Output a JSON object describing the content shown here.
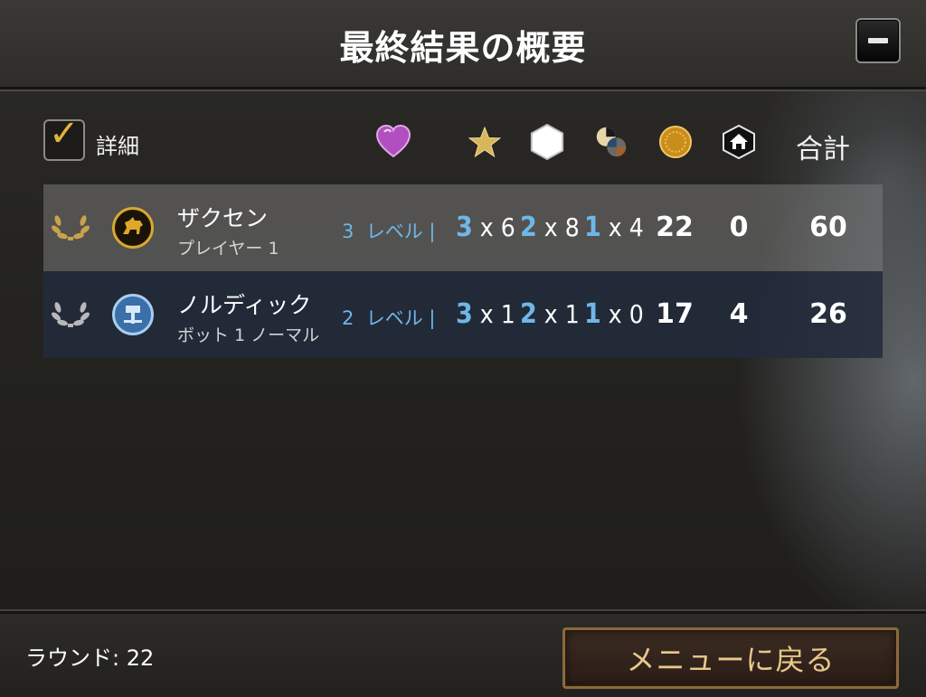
{
  "title": "最終結果の概要",
  "details": {
    "label": "詳細",
    "checked": true
  },
  "columns": {
    "icons": [
      "heart-icon",
      "star-icon",
      "hexagon-icon",
      "resource-mix-icon",
      "coin-icon",
      "home-icon"
    ],
    "total_label": "合計"
  },
  "players": [
    {
      "name": "ザクセン",
      "sub": "プレイヤー 1",
      "level_num": "3",
      "level_text": "レベル",
      "star": {
        "n": "3",
        "x": "x",
        "v": "6"
      },
      "hex": {
        "n": "2",
        "x": "x",
        "v": "8"
      },
      "res": {
        "n": "1",
        "x": "x",
        "v": "4"
      },
      "coins": "22",
      "buildings": "0",
      "total": "60",
      "laurel": "gold"
    },
    {
      "name": "ノルディック",
      "sub": "ボット 1 ノーマル",
      "level_num": "2",
      "level_text": "レベル",
      "star": {
        "n": "3",
        "x": "x",
        "v": "1"
      },
      "hex": {
        "n": "2",
        "x": "x",
        "v": "1"
      },
      "res": {
        "n": "1",
        "x": "x",
        "v": "0"
      },
      "coins": "17",
      "buildings": "4",
      "total": "26",
      "laurel": "silver"
    }
  ],
  "footer": {
    "round": "ラウンド: 22",
    "back_button": "メニューに戻る"
  }
}
